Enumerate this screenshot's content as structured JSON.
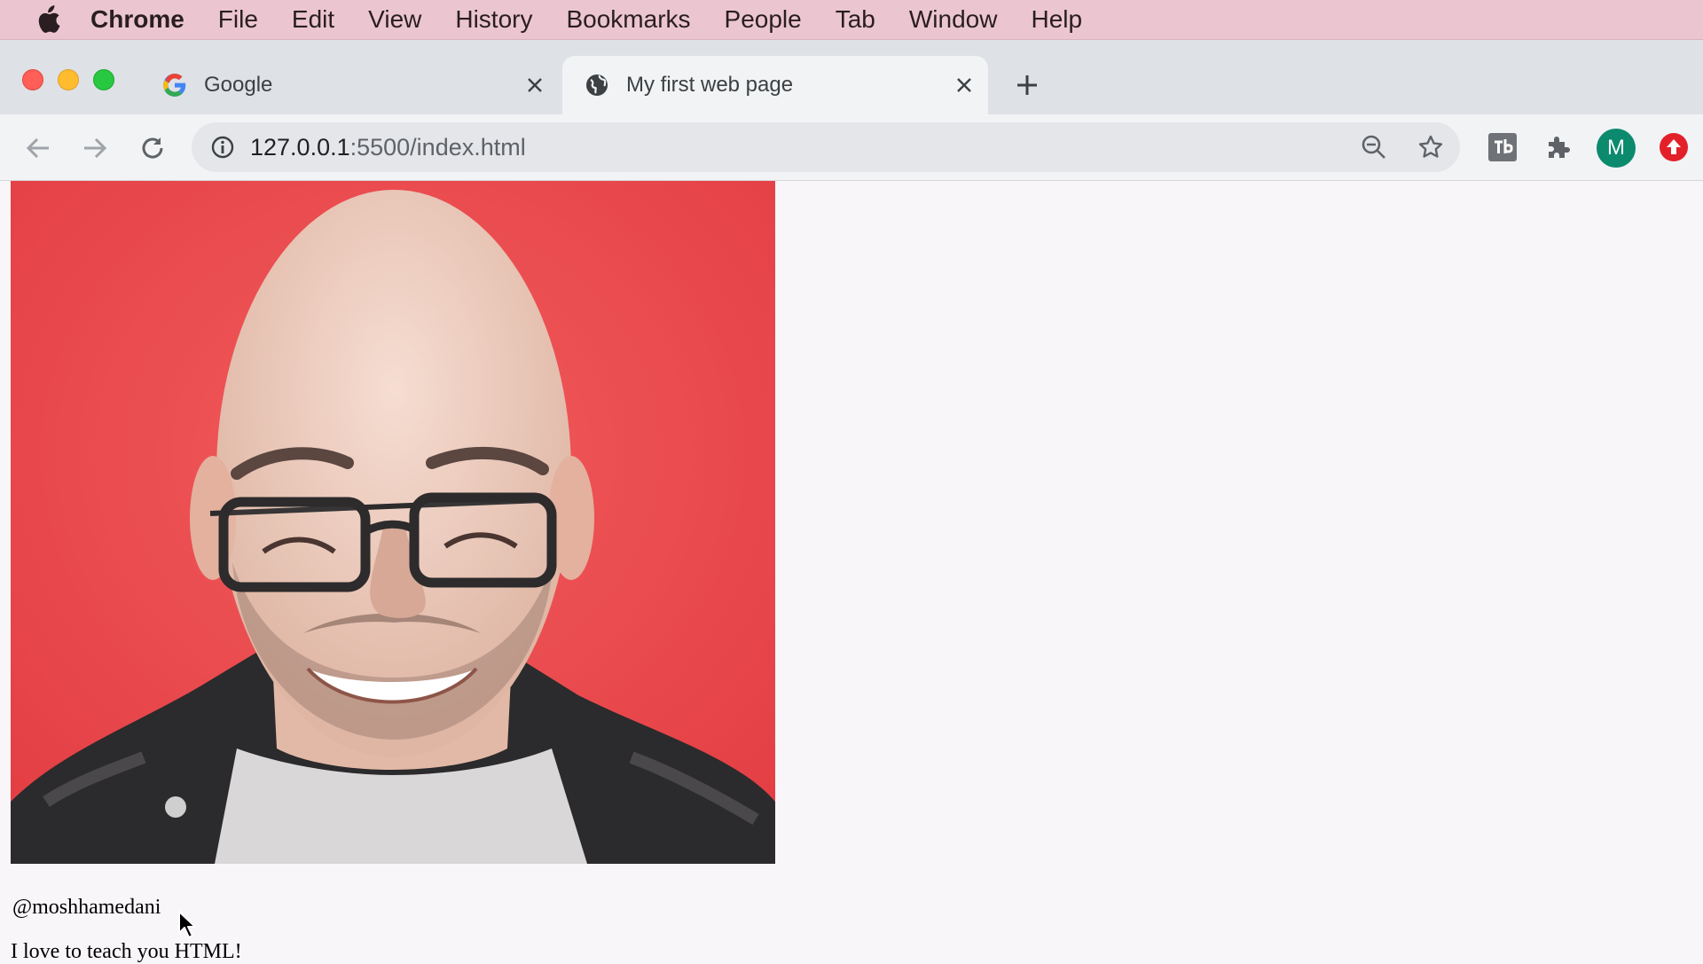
{
  "menubar": {
    "app": "Chrome",
    "items": [
      "File",
      "Edit",
      "View",
      "History",
      "Bookmarks",
      "People",
      "Tab",
      "Window",
      "Help"
    ]
  },
  "tabs": [
    {
      "title": "Google",
      "icon": "google-g-icon",
      "active": false
    },
    {
      "title": "My first web page",
      "icon": "globe-icon",
      "active": true
    }
  ],
  "address": {
    "host": "127.0.0.1",
    "rest": ":5500/index.html"
  },
  "profile": {
    "initial": "M",
    "color": "#0b8a6e"
  },
  "page": {
    "photo_alt": "Profile photo of a smiling bald man with glasses in front of a red wall",
    "handle": "@moshhamedani",
    "bio": "I love to teach you HTML!"
  },
  "colors": {
    "menubar": "#ebc6d0",
    "tabstrip": "#dee1e6",
    "toolbar": "#f1f3f4",
    "page_bg": "#f9f6fa",
    "photo_bg": "#ec4a4d"
  }
}
